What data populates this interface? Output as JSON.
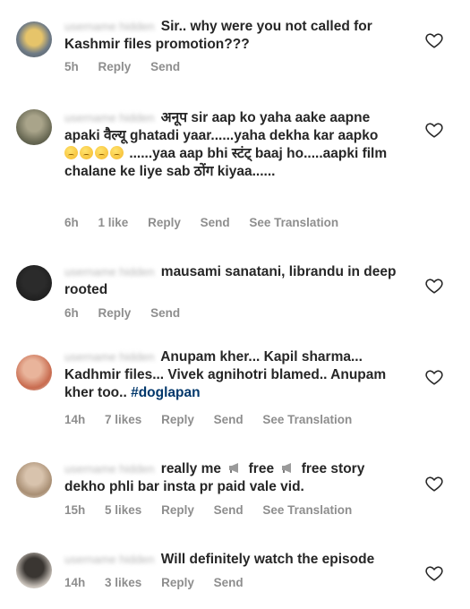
{
  "comments": [
    {
      "username": "username hidden",
      "text": "Sir.. why were you not called for Kashmir files promotion???",
      "time": "5h",
      "likes": "",
      "reply": "Reply",
      "send": "Send",
      "translation": ""
    },
    {
      "username": "username hidden",
      "text_part1": "अनूप sir aap ko yaha aake aapne apaki वैल्यू ghatadi yaar......yaha dekha kar aapko",
      "text_part2": "......yaa aap bhi स्टंट् baaj ho.....aapki film chalane ke liye sab ठोंग kiyaa......",
      "time": "6h",
      "likes": "1 like",
      "reply": "Reply",
      "send": "Send",
      "translation": "See Translation"
    },
    {
      "username": "username hidden",
      "text": "mausami sanatani,  librandu in deep rooted",
      "time": "6h",
      "likes": "",
      "reply": "Reply",
      "send": "Send",
      "translation": ""
    },
    {
      "username": "username hidden",
      "text": "Anupam kher... Kapil sharma... Kadhmir files... Vivek agnihotri blamed.. Anupam kher too..",
      "hashtag": "#doglapan",
      "time": "14h",
      "likes": "7 likes",
      "reply": "Reply",
      "send": "Send",
      "translation": "See Translation"
    },
    {
      "username": "username hidden",
      "text_part1": "really me",
      "text_part2": "free",
      "text_part3": "free story dekho phli bar insta pr paid vale vid.",
      "time": "15h",
      "likes": "5 likes",
      "reply": "Reply",
      "send": "Send",
      "translation": "See Translation"
    },
    {
      "username": "username hidden",
      "text": "Will definitely watch the episode",
      "time": "14h",
      "likes": "3 likes",
      "reply": "Reply",
      "send": "Send",
      "translation": ""
    }
  ],
  "icons": {
    "like": "heart-outline-icon",
    "emoji": "crying-face-emoji",
    "megaphone": "megaphone-emoji"
  },
  "colors": {
    "text": "#262626",
    "meta": "#8e8e8e",
    "hashtag": "#00376b"
  }
}
